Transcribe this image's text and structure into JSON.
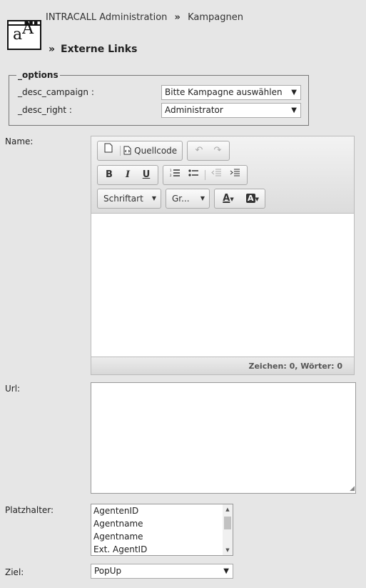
{
  "header": {
    "breadcrumb_root": "INTRACALL Administration",
    "breadcrumb_sep": "»",
    "breadcrumb_current": "Kampagnen",
    "title_sep": "»",
    "title": "Externe Links"
  },
  "options": {
    "legend": "_options",
    "campaign_label": "_desc_campaign :",
    "campaign_value": "Bitte Kampagne auswählen",
    "right_label": "_desc_right :",
    "right_value": "Administrator"
  },
  "form": {
    "name_label": "Name:",
    "url_label": "Url:",
    "placeholder_label": "Platzhalter:",
    "target_label": "Ziel:",
    "target_value": "PopUp",
    "placeholders": [
      "AgentenID",
      "Agentname",
      "Agentname",
      "Ext. AgentID"
    ]
  },
  "editor": {
    "source_label": "Quellcode",
    "bold": "B",
    "italic": "I",
    "underline": "U",
    "font_label": "Schriftart",
    "size_label": "Gr...",
    "text_color": "A",
    "bg_color": "A",
    "status": "Zeichen: 0, Wörter: 0"
  }
}
